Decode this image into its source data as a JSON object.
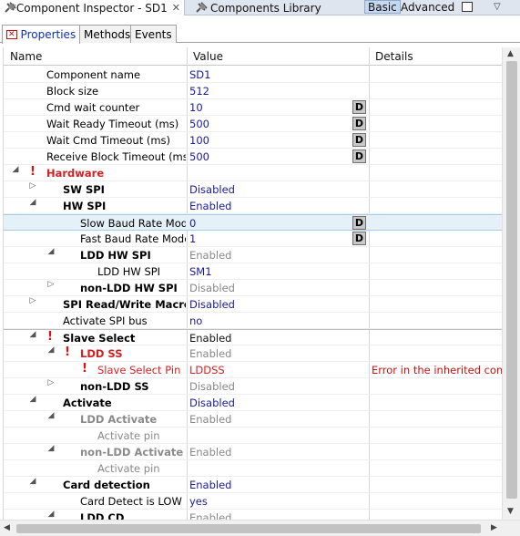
{
  "topbar": {
    "tab_inspector": "*Component Inspector - SD1",
    "tab_library": "Components Library",
    "basic": "Basic",
    "advanced": "Advanced"
  },
  "subtabs": [
    "Properties",
    "Methods",
    "Events"
  ],
  "columns": {
    "name": "Name",
    "value": "Value",
    "details": "Details"
  },
  "rows": [
    {
      "name": "Component name",
      "value": "SD1",
      "details": ""
    },
    {
      "name": "Block size",
      "value": "512",
      "details": ""
    },
    {
      "name": "Cmd wait counter",
      "value": "10",
      "details": ""
    },
    {
      "name": "Wait Ready Timeout (ms)",
      "value": "500",
      "details": ""
    },
    {
      "name": "Wait Cmd Timeout (ms)",
      "value": "100",
      "details": ""
    },
    {
      "name": "Receive Block Timeout (ms)",
      "value": "500",
      "details": ""
    },
    {
      "name": "Hardware",
      "value": "",
      "details": ""
    },
    {
      "name": "SW SPI",
      "value": "Disabled",
      "details": ""
    },
    {
      "name": "HW SPI",
      "value": "Enabled",
      "details": ""
    },
    {
      "name": "Slow Baud Rate Mode",
      "value": "0",
      "details": ""
    },
    {
      "name": "Fast Baud Rate Mode",
      "value": "1",
      "details": ""
    },
    {
      "name": "LDD HW SPI",
      "value": "Enabled",
      "details": ""
    },
    {
      "name": "LDD HW SPI",
      "value": "SM1",
      "details": ""
    },
    {
      "name": "non-LDD HW SPI",
      "value": "Disabled",
      "details": ""
    },
    {
      "name": "SPI Read/Write Macros",
      "value": "Disabled",
      "details": ""
    },
    {
      "name": "Activate SPI bus",
      "value": "no",
      "details": ""
    },
    {
      "name": "Slave Select",
      "value": "Enabled",
      "details": ""
    },
    {
      "name": "LDD SS",
      "value": "Enabled",
      "details": ""
    },
    {
      "name": "Slave Select Pin",
      "value": "LDDSS",
      "details": "Error in the inherited comp"
    },
    {
      "name": "non-LDD SS",
      "value": "Disabled",
      "details": ""
    },
    {
      "name": "Activate",
      "value": "Disabled",
      "details": ""
    },
    {
      "name": "LDD Activate",
      "value": "Enabled",
      "details": ""
    },
    {
      "name": "Activate pin",
      "value": "",
      "details": ""
    },
    {
      "name": "non-LDD Activate",
      "value": "Enabled",
      "details": ""
    },
    {
      "name": "Activate pin",
      "value": "",
      "details": ""
    },
    {
      "name": "Card detection",
      "value": "Enabled",
      "details": ""
    },
    {
      "name": "Card Detect is LOW active",
      "value": "yes",
      "details": ""
    },
    {
      "name": "LDD CD",
      "value": "Enabled",
      "details": ""
    }
  ],
  "colors": {
    "accent_blue": "#1a1a9c",
    "error_red": "#d42020",
    "disabled_gray": "#888888",
    "selection": "#e5f1f9"
  },
  "icons": {
    "component": "plug-icon",
    "warning": "exclamation-icon",
    "d_button": "D"
  }
}
